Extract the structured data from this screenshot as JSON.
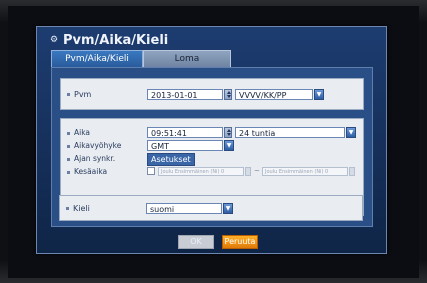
{
  "window": {
    "title": "Pvm/Aika/Kieli"
  },
  "tabs": [
    {
      "label": "Pvm/Aika/Kieli"
    },
    {
      "label": "Loma"
    }
  ],
  "date_section": {
    "date_label": "Pvm",
    "date_value": "2013-01-01",
    "format_value": "VVVV/KK/PP"
  },
  "time_section": {
    "time_label": "Aika",
    "time_value": "09:51:41",
    "time_format_value": "24 tuntia",
    "timezone_label": "Aikavyöhyke",
    "timezone_value": "GMT",
    "sync_label": "Ajan synkr.",
    "sync_button": "Asetukset",
    "dst_label": "Kesäaika",
    "dst_from": "Joulu Ensimmäinen (Ni) 0",
    "dst_separator": "~",
    "dst_to": "Joulu Ensimmäinen (Ni) 0"
  },
  "language_section": {
    "label": "Kieli",
    "value": "suomi"
  },
  "footer": {
    "ok_label": "OK",
    "cancel_label": "Peruuta"
  }
}
